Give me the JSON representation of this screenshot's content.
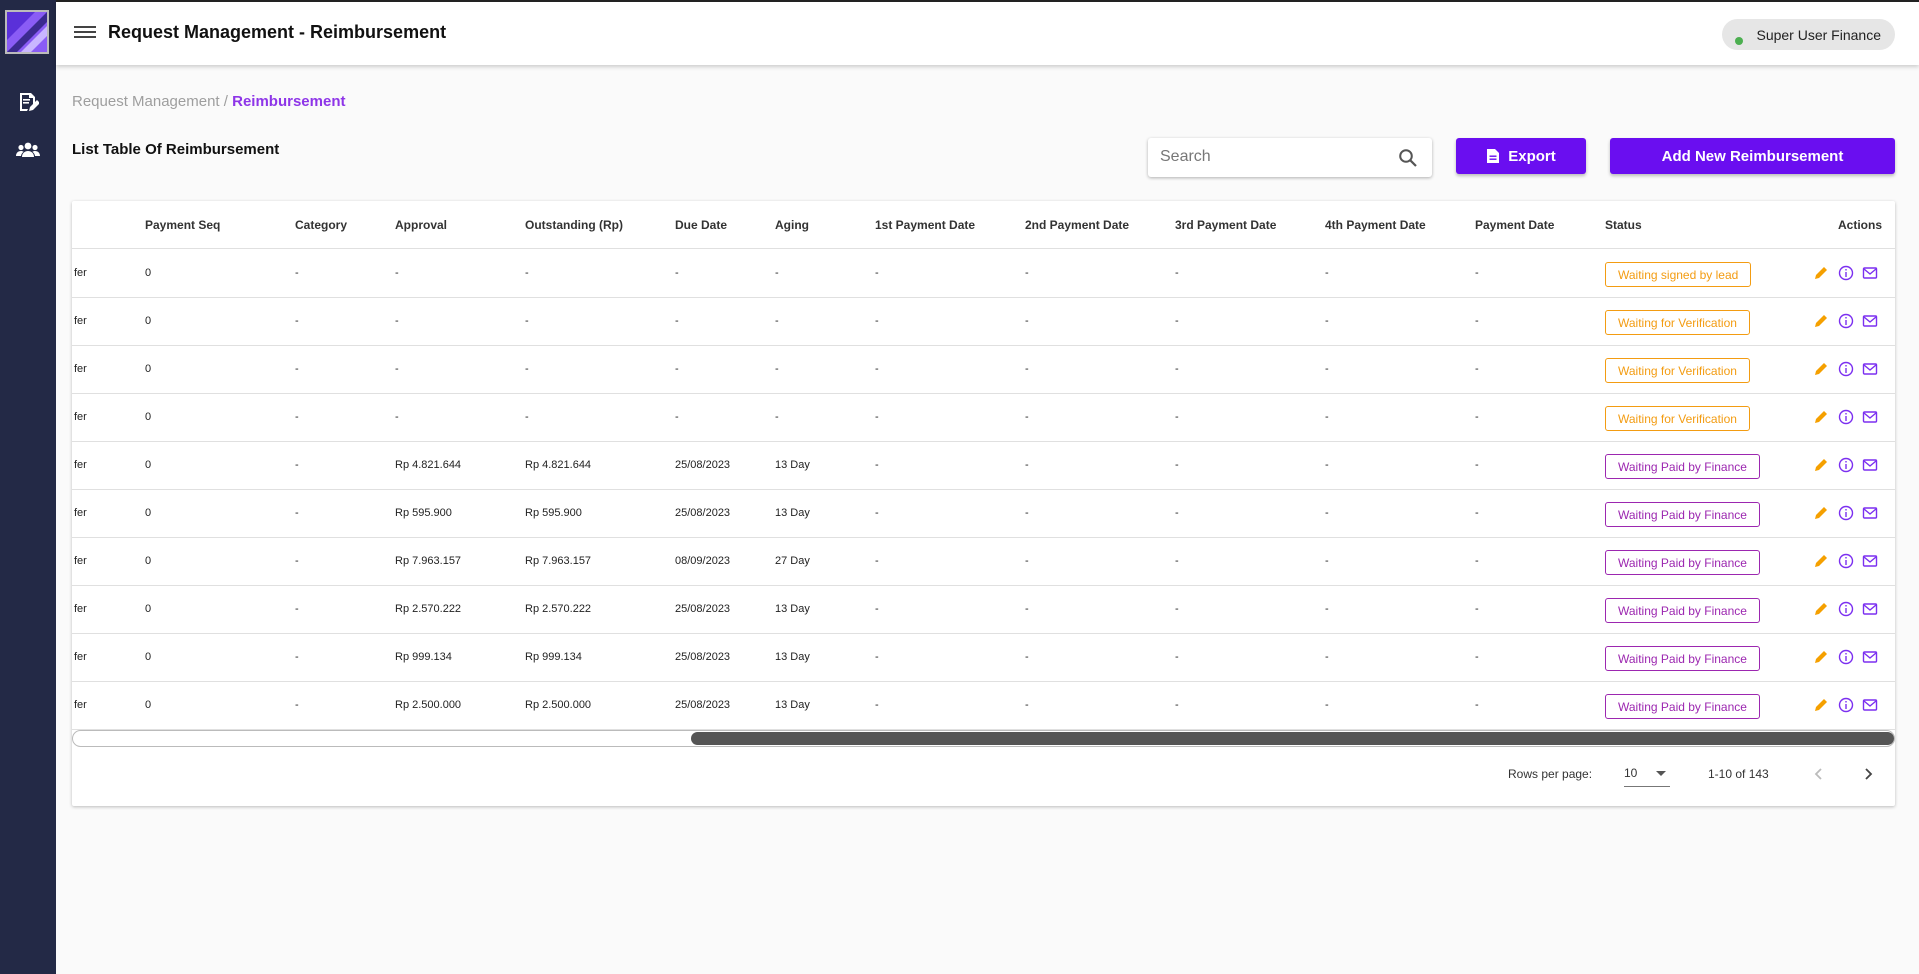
{
  "header": {
    "title": "Request Management - Reimbursement",
    "user_name": "Super User Finance"
  },
  "breadcrumb": {
    "parent": "Request Management",
    "separator": "/",
    "current": "Reimbursement"
  },
  "list": {
    "title": "List Table Of Reimbursement"
  },
  "search": {
    "placeholder": "Search"
  },
  "buttons": {
    "export": "Export",
    "add_new": "Add New Reimbursement"
  },
  "table": {
    "columns": [
      "Payment Seq",
      "Category",
      "Approval",
      "Outstanding (Rp)",
      "Due Date",
      "Aging",
      "1st Payment Date",
      "2nd Payment Date",
      "3rd Payment Date",
      "4th Payment Date",
      "Payment Date",
      "Status",
      "Actions"
    ],
    "rows": [
      {
        "prefix": "fer",
        "payment_seq": "0",
        "category": "-",
        "approval": "-",
        "outstanding": "-",
        "due_date": "-",
        "aging": "-",
        "p1": "-",
        "p2": "-",
        "p3": "-",
        "p4": "-",
        "payment_date": "-",
        "status": "Waiting signed by lead"
      },
      {
        "prefix": "fer",
        "payment_seq": "0",
        "category": "-",
        "approval": "-",
        "outstanding": "-",
        "due_date": "-",
        "aging": "-",
        "p1": "-",
        "p2": "-",
        "p3": "-",
        "p4": "-",
        "payment_date": "-",
        "status": "Waiting for Verification"
      },
      {
        "prefix": "fer",
        "payment_seq": "0",
        "category": "-",
        "approval": "-",
        "outstanding": "-",
        "due_date": "-",
        "aging": "-",
        "p1": "-",
        "p2": "-",
        "p3": "-",
        "p4": "-",
        "payment_date": "-",
        "status": "Waiting for Verification"
      },
      {
        "prefix": "fer",
        "payment_seq": "0",
        "category": "-",
        "approval": "-",
        "outstanding": "-",
        "due_date": "-",
        "aging": "-",
        "p1": "-",
        "p2": "-",
        "p3": "-",
        "p4": "-",
        "payment_date": "-",
        "status": "Waiting for Verification"
      },
      {
        "prefix": "fer",
        "payment_seq": "0",
        "category": "-",
        "approval": "Rp 4.821.644",
        "outstanding": "Rp 4.821.644",
        "due_date": "25/08/2023",
        "aging": "13 Day",
        "p1": "-",
        "p2": "-",
        "p3": "-",
        "p4": "-",
        "payment_date": "-",
        "status": "Waiting Paid by Finance"
      },
      {
        "prefix": "fer",
        "payment_seq": "0",
        "category": "-",
        "approval": "Rp 595.900",
        "outstanding": "Rp 595.900",
        "due_date": "25/08/2023",
        "aging": "13 Day",
        "p1": "-",
        "p2": "-",
        "p3": "-",
        "p4": "-",
        "payment_date": "-",
        "status": "Waiting Paid by Finance"
      },
      {
        "prefix": "fer",
        "payment_seq": "0",
        "category": "-",
        "approval": "Rp 7.963.157",
        "outstanding": "Rp 7.963.157",
        "due_date": "08/09/2023",
        "aging": "27 Day",
        "p1": "-",
        "p2": "-",
        "p3": "-",
        "p4": "-",
        "payment_date": "-",
        "status": "Waiting Paid by Finance"
      },
      {
        "prefix": "fer",
        "payment_seq": "0",
        "category": "-",
        "approval": "Rp 2.570.222",
        "outstanding": "Rp 2.570.222",
        "due_date": "25/08/2023",
        "aging": "13 Day",
        "p1": "-",
        "p2": "-",
        "p3": "-",
        "p4": "-",
        "payment_date": "-",
        "status": "Waiting Paid by Finance"
      },
      {
        "prefix": "fer",
        "payment_seq": "0",
        "category": "-",
        "approval": "Rp 999.134",
        "outstanding": "Rp 999.134",
        "due_date": "25/08/2023",
        "aging": "13 Day",
        "p1": "-",
        "p2": "-",
        "p3": "-",
        "p4": "-",
        "payment_date": "-",
        "status": "Waiting Paid by Finance"
      },
      {
        "prefix": "fer",
        "payment_seq": "0",
        "category": "-",
        "approval": "Rp 2.500.000",
        "outstanding": "Rp 2.500.000",
        "due_date": "25/08/2023",
        "aging": "13 Day",
        "p1": "-",
        "p2": "-",
        "p3": "-",
        "p4": "-",
        "payment_date": "-",
        "status": "Waiting Paid by Finance"
      }
    ]
  },
  "pagination": {
    "rows_per_page_label": "Rows per page:",
    "rows_per_page": "10",
    "range": "1-10 of 143"
  },
  "colors": {
    "primary": "#6a0ef0",
    "breadcrumb_active": "#8e35e8",
    "sidebar": "#232946",
    "status_orange": "#f39c12",
    "status_purple": "#9c27b0",
    "action_edit": "#f5a000",
    "action_info": "#7b2ff0"
  },
  "icons": {
    "sidebar": [
      "document-edit-icon",
      "users-group-icon"
    ],
    "row_actions": [
      "edit-icon",
      "info-icon",
      "mail-icon"
    ]
  }
}
